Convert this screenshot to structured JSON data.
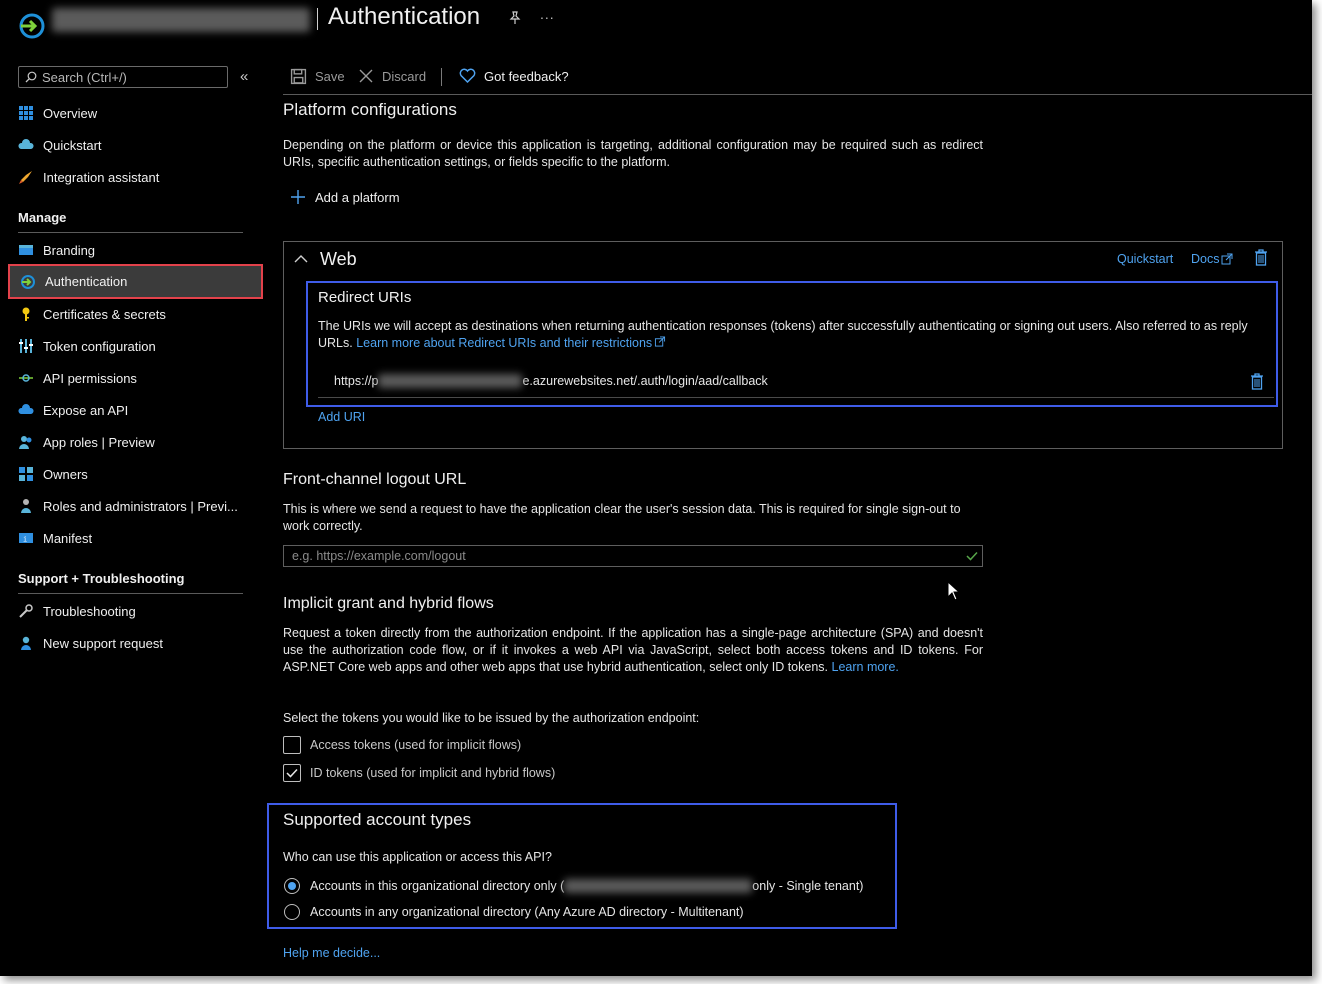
{
  "header": {
    "page_title": "Authentication",
    "more": "..."
  },
  "sidebar": {
    "search_placeholder": "Search (Ctrl+/)",
    "collapse": "«",
    "items_top": [
      {
        "label": "Overview"
      },
      {
        "label": "Quickstart"
      },
      {
        "label": "Integration assistant"
      }
    ],
    "manage_heading": "Manage",
    "manage_items": [
      {
        "label": "Branding"
      },
      {
        "label": "Authentication"
      },
      {
        "label": "Certificates & secrets"
      },
      {
        "label": "Token configuration"
      },
      {
        "label": "API permissions"
      },
      {
        "label": "Expose an API"
      },
      {
        "label": "App roles | Preview"
      },
      {
        "label": "Owners"
      },
      {
        "label": "Roles and administrators | Previ..."
      },
      {
        "label": "Manifest"
      }
    ],
    "support_heading": "Support + Troubleshooting",
    "support_items": [
      {
        "label": "Troubleshooting"
      },
      {
        "label": "New support request"
      }
    ]
  },
  "toolbar": {
    "save": "Save",
    "discard": "Discard",
    "feedback": "Got feedback?"
  },
  "platform": {
    "heading": "Platform configurations",
    "description": "Depending on the platform or device this application is targeting, additional configuration may be required such as redirect URIs, specific authentication settings, or fields specific to the platform.",
    "add_platform": "Add a platform"
  },
  "web": {
    "title": "Web",
    "quickstart": "Quickstart",
    "docs": "Docs",
    "redirect_heading": "Redirect URIs",
    "redirect_desc": "The URIs we will accept as destinations when returning authentication responses (tokens) after successfully authenticating or signing out users. Also referred to as reply URLs.",
    "redirect_link": "Learn more about Redirect URIs and their restrictions",
    "uri_prefix": "https://p",
    "uri_suffix": "e.azurewebsites.net/.auth/login/aad/callback",
    "add_uri": "Add URI"
  },
  "logout": {
    "heading": "Front-channel logout URL",
    "description": "This is where we send a request to have the application clear the user's session data. This is required for single sign-out to work correctly.",
    "placeholder": "e.g. https://example.com/logout"
  },
  "implicit": {
    "heading": "Implicit grant and hybrid flows",
    "description": "Request a token directly from the authorization endpoint. If the application has a single-page architecture (SPA) and doesn't use the authorization code flow, or if it invokes a web API via JavaScript, select both access tokens and ID tokens. For ASP.NET Core web apps and other web apps that use hybrid authentication, select only ID tokens.",
    "learn_more": "Learn more.",
    "select_prompt": "Select the tokens you would like to be issued by the authorization endpoint:",
    "access_tokens": {
      "label": "Access tokens (used for implicit flows)",
      "checked": false
    },
    "id_tokens": {
      "label": "ID tokens (used for implicit and hybrid flows)",
      "checked": true
    }
  },
  "accounts": {
    "heading": "Supported account types",
    "question": "Who can use this application or access this API?",
    "single": {
      "label_prefix": "Accounts in this organizational directory only (",
      "label_suffix": " only - Single tenant)",
      "selected": true
    },
    "multi": {
      "label": "Accounts in any organizational directory (Any Azure AD directory - Multitenant)",
      "selected": false
    },
    "help": "Help me decide..."
  },
  "colors": {
    "background": "#000000",
    "link": "#4fa3f0",
    "highlight_red": "#e3424b",
    "highlight_blue": "#3f5ce8"
  }
}
